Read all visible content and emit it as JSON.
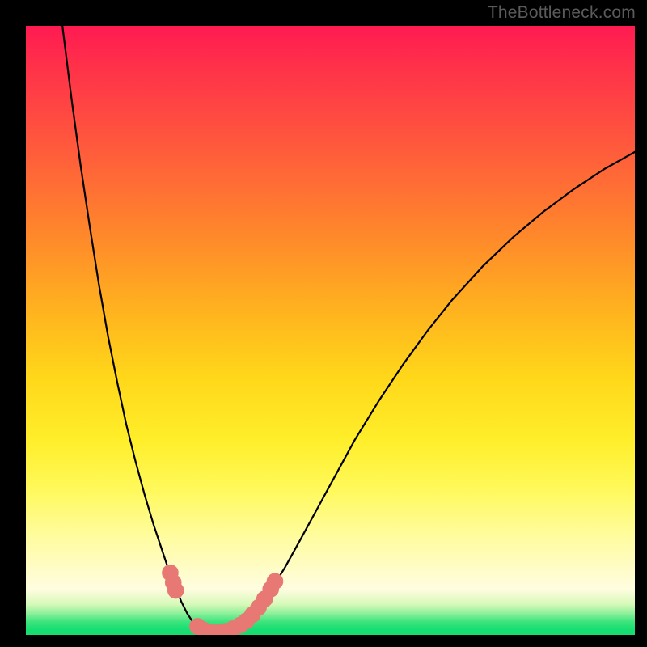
{
  "watermark": {
    "text": "TheBottleneck.com"
  },
  "colors": {
    "curve_stroke": "#000000",
    "marker_fill": "#e77874",
    "marker_stroke": "#e77874"
  },
  "chart_data": {
    "type": "line",
    "title": "",
    "xlabel": "",
    "ylabel": "",
    "xlim": [
      0,
      100
    ],
    "ylim": [
      0,
      100
    ],
    "grid": false,
    "legend": false,
    "curve": [
      {
        "x": 6.0,
        "y": 100.0
      },
      {
        "x": 7.5,
        "y": 88.0
      },
      {
        "x": 9.0,
        "y": 77.0
      },
      {
        "x": 10.5,
        "y": 67.0
      },
      {
        "x": 12.0,
        "y": 57.5
      },
      {
        "x": 13.5,
        "y": 49.0
      },
      {
        "x": 15.0,
        "y": 41.5
      },
      {
        "x": 16.5,
        "y": 34.5
      },
      {
        "x": 18.0,
        "y": 28.5
      },
      {
        "x": 19.5,
        "y": 23.0
      },
      {
        "x": 21.0,
        "y": 18.0
      },
      {
        "x": 22.5,
        "y": 13.5
      },
      {
        "x": 23.5,
        "y": 10.5
      },
      {
        "x": 24.5,
        "y": 8.0
      },
      {
        "x": 25.5,
        "y": 5.5
      },
      {
        "x": 26.5,
        "y": 3.5
      },
      {
        "x": 27.5,
        "y": 2.0
      },
      {
        "x": 28.5,
        "y": 1.0
      },
      {
        "x": 29.5,
        "y": 0.4
      },
      {
        "x": 31.0,
        "y": 0.1
      },
      {
        "x": 32.5,
        "y": 0.2
      },
      {
        "x": 34.0,
        "y": 0.7
      },
      {
        "x": 35.5,
        "y": 1.6
      },
      {
        "x": 37.0,
        "y": 3.0
      },
      {
        "x": 38.5,
        "y": 4.8
      },
      {
        "x": 40.0,
        "y": 7.0
      },
      {
        "x": 42.5,
        "y": 11.0
      },
      {
        "x": 45.0,
        "y": 15.5
      },
      {
        "x": 48.0,
        "y": 21.0
      },
      {
        "x": 51.0,
        "y": 26.5
      },
      {
        "x": 54.0,
        "y": 32.0
      },
      {
        "x": 58.0,
        "y": 38.5
      },
      {
        "x": 62.0,
        "y": 44.5
      },
      {
        "x": 66.0,
        "y": 50.0
      },
      {
        "x": 70.0,
        "y": 55.0
      },
      {
        "x": 75.0,
        "y": 60.5
      },
      {
        "x": 80.0,
        "y": 65.3
      },
      {
        "x": 85.0,
        "y": 69.5
      },
      {
        "x": 90.0,
        "y": 73.2
      },
      {
        "x": 95.0,
        "y": 76.5
      },
      {
        "x": 100.0,
        "y": 79.3
      }
    ],
    "markers": [
      {
        "x": 23.7,
        "y": 10.2
      },
      {
        "x": 24.2,
        "y": 8.6
      },
      {
        "x": 24.6,
        "y": 7.3
      },
      {
        "x": 28.2,
        "y": 1.4
      },
      {
        "x": 29.2,
        "y": 0.8
      },
      {
        "x": 30.4,
        "y": 0.4
      },
      {
        "x": 31.6,
        "y": 0.4
      },
      {
        "x": 32.8,
        "y": 0.6
      },
      {
        "x": 34.0,
        "y": 1.0
      },
      {
        "x": 35.2,
        "y": 1.6
      },
      {
        "x": 36.2,
        "y": 2.3
      },
      {
        "x": 37.2,
        "y": 3.3
      },
      {
        "x": 38.2,
        "y": 4.5
      },
      {
        "x": 39.2,
        "y": 5.9
      },
      {
        "x": 40.2,
        "y": 7.5
      },
      {
        "x": 40.9,
        "y": 8.8
      }
    ],
    "marker_radius_pct": 1.3
  }
}
